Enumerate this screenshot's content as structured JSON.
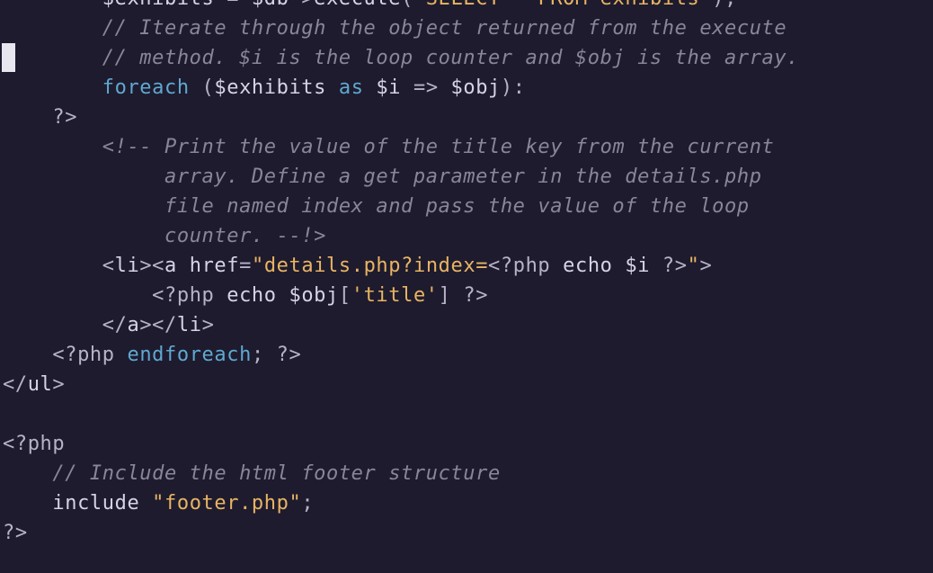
{
  "editor": {
    "language": "php",
    "theme": {
      "background": "#1e1b2e",
      "comment": "#8a8598",
      "keyword": "#5fa8d0",
      "string": "#e8b463",
      "text": "#d8d2e6",
      "cursor": "#e8e6ef"
    },
    "lines": [
      {
        "tokens": [
          {
            "t": "        ",
            "c": "ws"
          },
          {
            "t": "$exhibits",
            "c": "vr"
          },
          {
            "t": " = ",
            "c": "pu"
          },
          {
            "t": "$db",
            "c": "vr"
          },
          {
            "t": "->",
            "c": "pu"
          },
          {
            "t": "execute",
            "c": "tg"
          },
          {
            "t": "(",
            "c": "pu"
          },
          {
            "t": "'SELECT * FROM exhibits'",
            "c": "st"
          },
          {
            "t": ");",
            "c": "pu"
          }
        ]
      },
      {
        "tokens": [
          {
            "t": "        ",
            "c": "ws"
          },
          {
            "t": "// Iterate through the object returned from the execute",
            "c": "cm"
          }
        ]
      },
      {
        "tokens": [
          {
            "t": "        ",
            "c": "ws"
          },
          {
            "t": "// method. $i is the loop counter and $obj is the array.",
            "c": "cm"
          }
        ]
      },
      {
        "tokens": [
          {
            "t": "        ",
            "c": "ws"
          },
          {
            "t": "foreach",
            "c": "kw"
          },
          {
            "t": " (",
            "c": "pu"
          },
          {
            "t": "$exhibits",
            "c": "vr"
          },
          {
            "t": " ",
            "c": "pu"
          },
          {
            "t": "as",
            "c": "kw"
          },
          {
            "t": " ",
            "c": "pu"
          },
          {
            "t": "$i",
            "c": "vr"
          },
          {
            "t": " => ",
            "c": "pu"
          },
          {
            "t": "$obj",
            "c": "vr"
          },
          {
            "t": "):",
            "c": "pu"
          }
        ]
      },
      {
        "tokens": [
          {
            "t": "    ",
            "c": "ws"
          },
          {
            "t": "?>",
            "c": "ph"
          }
        ]
      },
      {
        "tokens": [
          {
            "t": "        ",
            "c": "ws"
          },
          {
            "t": "<!-- Print the value of the title key from the current",
            "c": "cm"
          }
        ]
      },
      {
        "tokens": [
          {
            "t": "             ",
            "c": "ws"
          },
          {
            "t": "array. Define a get parameter in the details.php",
            "c": "cm"
          }
        ]
      },
      {
        "tokens": [
          {
            "t": "             ",
            "c": "ws"
          },
          {
            "t": "file named index and pass the value of the loop",
            "c": "cm"
          }
        ]
      },
      {
        "tokens": [
          {
            "t": "             ",
            "c": "ws"
          },
          {
            "t": "counter. --!>",
            "c": "cm"
          }
        ]
      },
      {
        "tokens": [
          {
            "t": "        ",
            "c": "ws"
          },
          {
            "t": "<",
            "c": "pu"
          },
          {
            "t": "li",
            "c": "tg"
          },
          {
            "t": "><",
            "c": "pu"
          },
          {
            "t": "a",
            "c": "tg"
          },
          {
            "t": " href",
            "c": "tg"
          },
          {
            "t": "=",
            "c": "pu"
          },
          {
            "t": "\"details.php?index=",
            "c": "st"
          },
          {
            "t": "<?php",
            "c": "ph"
          },
          {
            "t": " echo ",
            "c": "tg"
          },
          {
            "t": "$i",
            "c": "vr"
          },
          {
            "t": " ?>",
            "c": "ph"
          },
          {
            "t": "\"",
            "c": "st"
          },
          {
            "t": ">",
            "c": "pu"
          }
        ]
      },
      {
        "tokens": [
          {
            "t": "            ",
            "c": "ws"
          },
          {
            "t": "<?php",
            "c": "ph"
          },
          {
            "t": " echo ",
            "c": "tg"
          },
          {
            "t": "$obj",
            "c": "vr"
          },
          {
            "t": "[",
            "c": "pu"
          },
          {
            "t": "'title'",
            "c": "st"
          },
          {
            "t": "] ",
            "c": "pu"
          },
          {
            "t": "?>",
            "c": "ph"
          }
        ]
      },
      {
        "tokens": [
          {
            "t": "        ",
            "c": "ws"
          },
          {
            "t": "</",
            "c": "pu"
          },
          {
            "t": "a",
            "c": "tg"
          },
          {
            "t": "></",
            "c": "pu"
          },
          {
            "t": "li",
            "c": "tg"
          },
          {
            "t": ">",
            "c": "pu"
          }
        ]
      },
      {
        "tokens": [
          {
            "t": "    ",
            "c": "ws"
          },
          {
            "t": "<?php",
            "c": "ph"
          },
          {
            "t": " ",
            "c": "pu"
          },
          {
            "t": "endforeach",
            "c": "kw"
          },
          {
            "t": "; ",
            "c": "pu"
          },
          {
            "t": "?>",
            "c": "ph"
          }
        ]
      },
      {
        "tokens": [
          {
            "t": "</",
            "c": "pu"
          },
          {
            "t": "ul",
            "c": "tg"
          },
          {
            "t": ">",
            "c": "pu"
          }
        ]
      },
      {
        "tokens": []
      },
      {
        "tokens": [
          {
            "t": "<?php",
            "c": "ph"
          }
        ]
      },
      {
        "tokens": [
          {
            "t": "    ",
            "c": "ws"
          },
          {
            "t": "// Include the html footer structure",
            "c": "cm"
          }
        ]
      },
      {
        "tokens": [
          {
            "t": "    ",
            "c": "ws"
          },
          {
            "t": "include",
            "c": "tg"
          },
          {
            "t": " ",
            "c": "pu"
          },
          {
            "t": "\"footer.php\"",
            "c": "st"
          },
          {
            "t": ";",
            "c": "pu"
          }
        ]
      },
      {
        "tokens": [
          {
            "t": "?>",
            "c": "ph"
          }
        ]
      }
    ]
  }
}
